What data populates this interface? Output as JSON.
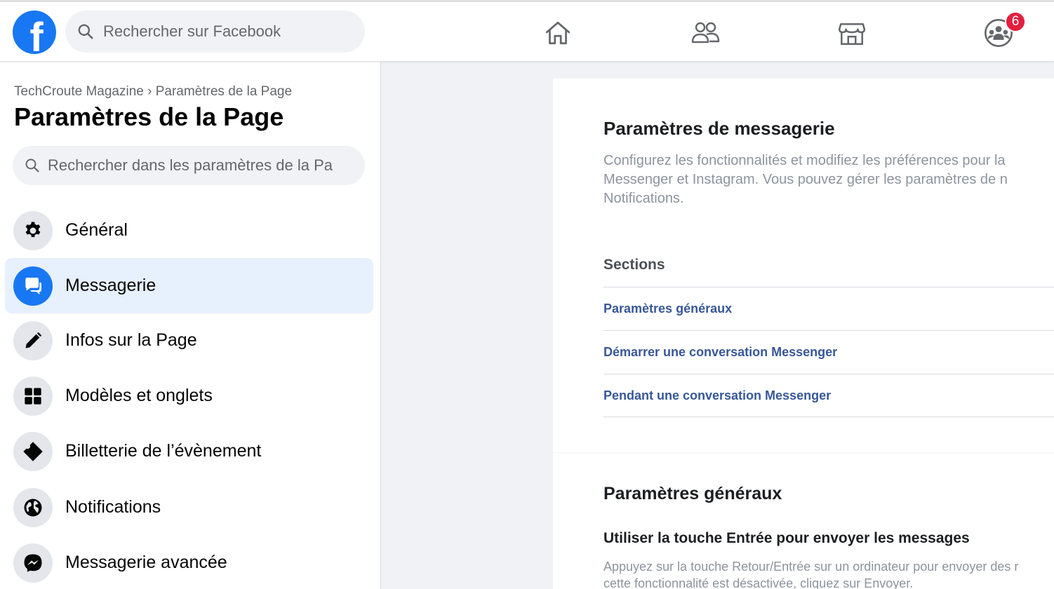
{
  "topbar": {
    "logo_letter": "f",
    "search_placeholder": "Rechercher sur Facebook",
    "nav_icons": [
      "home-icon",
      "friends-icon",
      "marketplace-icon",
      "groups-icon"
    ],
    "groups_badge": "6"
  },
  "sidebar": {
    "breadcrumb": "TechCroute Magazine › Paramètres de la Page",
    "title": "Paramètres de la Page",
    "search_placeholder": "Rechercher dans les paramètres de la Pa",
    "items": [
      {
        "label": "Général",
        "icon": "gear-icon",
        "active": false
      },
      {
        "label": "Messagerie",
        "icon": "chat-bubbles-icon",
        "active": true
      },
      {
        "label": "Infos sur la Page",
        "icon": "pencil-icon",
        "active": false
      },
      {
        "label": "Modèles et onglets",
        "icon": "grid-icon",
        "active": false
      },
      {
        "label": "Billetterie de l’évènement",
        "icon": "ticket-icon",
        "active": false
      },
      {
        "label": "Notifications",
        "icon": "globe-icon",
        "active": false
      },
      {
        "label": "Messagerie avancée",
        "icon": "messenger-icon",
        "active": false
      }
    ]
  },
  "main": {
    "messaging_title": "Paramètres de messagerie",
    "description_lines": [
      "Configurez les fonctionnalités et modifiez les préférences pour la",
      "Messenger et Instagram. Vous pouvez gérer les paramètres de n",
      "Notifications."
    ],
    "sections_title": "Sections",
    "section_links": [
      "Paramètres généraux",
      "Démarrer une conversation Messenger",
      "Pendant une conversation Messenger"
    ],
    "general_title": "Paramètres généraux",
    "enter_title": "Utiliser la touche Entrée pour envoyer les messages",
    "enter_desc_lines": [
      "Appuyez sur la touche Retour/Entrée sur un ordinateur pour envoyer des r",
      "cette fonctionnalité est désactivée, cliquez sur Envoyer."
    ]
  },
  "colors": {
    "brand_blue": "#1877f2",
    "link_blue": "#385898",
    "active_bg": "#e7f0fd",
    "badge_red": "#e41e3f"
  }
}
